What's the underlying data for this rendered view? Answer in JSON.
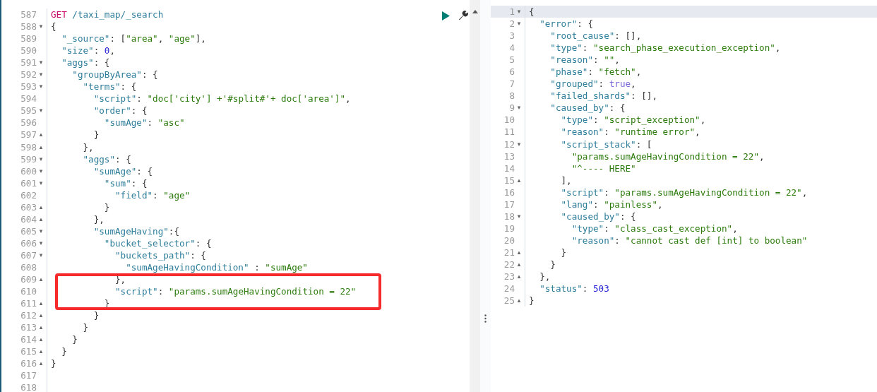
{
  "request_editor": {
    "lines": [
      {
        "number": "587",
        "code": [
          {
            "kind": "method",
            "text": "GET"
          },
          {
            "kind": "path",
            "text": " /taxi_map/_search"
          }
        ]
      },
      {
        "number": "588",
        "fold": "▾",
        "code": [
          {
            "kind": "punct",
            "text": "{"
          }
        ]
      },
      {
        "number": "589",
        "code": [
          {
            "kind": "key",
            "text": "  \"_source\""
          },
          {
            "kind": "punct",
            "text": ": ["
          },
          {
            "kind": "string",
            "text": "\"area\""
          },
          {
            "kind": "punct",
            "text": ", "
          },
          {
            "kind": "string",
            "text": "\"age\""
          },
          {
            "kind": "punct",
            "text": "],"
          }
        ]
      },
      {
        "number": "590",
        "code": [
          {
            "kind": "key",
            "text": "  \"size\""
          },
          {
            "kind": "punct",
            "text": ": "
          },
          {
            "kind": "number",
            "text": "0"
          },
          {
            "kind": "punct",
            "text": ","
          }
        ]
      },
      {
        "number": "591",
        "fold": "▾",
        "code": [
          {
            "kind": "key",
            "text": "  \"aggs\""
          },
          {
            "kind": "punct",
            "text": ": {"
          }
        ]
      },
      {
        "number": "592",
        "fold": "▾",
        "code": [
          {
            "kind": "key",
            "text": "    \"groupByArea\""
          },
          {
            "kind": "punct",
            "text": ": {"
          }
        ]
      },
      {
        "number": "593",
        "fold": "▾",
        "code": [
          {
            "kind": "key",
            "text": "      \"terms\""
          },
          {
            "kind": "punct",
            "text": ": {"
          }
        ]
      },
      {
        "number": "594",
        "code": [
          {
            "kind": "key",
            "text": "        \"script\""
          },
          {
            "kind": "punct",
            "text": ": "
          },
          {
            "kind": "string",
            "text": "\"doc['city'] +'#split#'+ doc['area']\""
          },
          {
            "kind": "punct",
            "text": ","
          }
        ]
      },
      {
        "number": "595",
        "fold": "▾",
        "code": [
          {
            "kind": "key",
            "text": "        \"order\""
          },
          {
            "kind": "punct",
            "text": ": {"
          }
        ]
      },
      {
        "number": "596",
        "code": [
          {
            "kind": "key",
            "text": "          \"sumAge\""
          },
          {
            "kind": "punct",
            "text": ": "
          },
          {
            "kind": "string",
            "text": "\"asc\""
          }
        ]
      },
      {
        "number": "597",
        "fold": "▴",
        "code": [
          {
            "kind": "punct",
            "text": "        }"
          }
        ]
      },
      {
        "number": "598",
        "fold": "▴",
        "code": [
          {
            "kind": "punct",
            "text": "      },"
          }
        ]
      },
      {
        "number": "599",
        "fold": "▾",
        "code": [
          {
            "kind": "key",
            "text": "      \"aggs\""
          },
          {
            "kind": "punct",
            "text": ": {"
          }
        ]
      },
      {
        "number": "600",
        "fold": "▾",
        "code": [
          {
            "kind": "key",
            "text": "        \"sumAge\""
          },
          {
            "kind": "punct",
            "text": ": {"
          }
        ]
      },
      {
        "number": "601",
        "fold": "▾",
        "code": [
          {
            "kind": "key",
            "text": "          \"sum\""
          },
          {
            "kind": "punct",
            "text": ": {"
          }
        ]
      },
      {
        "number": "602",
        "code": [
          {
            "kind": "key",
            "text": "            \"field\""
          },
          {
            "kind": "punct",
            "text": ": "
          },
          {
            "kind": "string",
            "text": "\"age\""
          }
        ]
      },
      {
        "number": "603",
        "fold": "▴",
        "code": [
          {
            "kind": "punct",
            "text": "          }"
          }
        ]
      },
      {
        "number": "604",
        "fold": "▴",
        "code": [
          {
            "kind": "punct",
            "text": "        },"
          }
        ]
      },
      {
        "number": "605",
        "fold": "▾",
        "code": [
          {
            "kind": "key",
            "text": "        \"sumAgeHaving\""
          },
          {
            "kind": "punct",
            "text": ":{"
          }
        ]
      },
      {
        "number": "606",
        "fold": "▾",
        "code": [
          {
            "kind": "key",
            "text": "          \"bucket_selector\""
          },
          {
            "kind": "punct",
            "text": ": {"
          }
        ]
      },
      {
        "number": "607",
        "fold": "▾",
        "code": [
          {
            "kind": "key",
            "text": "            \"buckets_path\""
          },
          {
            "kind": "punct",
            "text": ": {"
          }
        ]
      },
      {
        "number": "608",
        "code": [
          {
            "kind": "key",
            "text": "              \"sumAgeHavingCondition\""
          },
          {
            "kind": "punct",
            "text": " : "
          },
          {
            "kind": "string",
            "text": "\"sumAge\""
          }
        ]
      },
      {
        "number": "609",
        "fold": "▴",
        "code": [
          {
            "kind": "punct",
            "text": "            },"
          }
        ]
      },
      {
        "number": "610",
        "code": [
          {
            "kind": "key",
            "text": "            \"script\""
          },
          {
            "kind": "punct",
            "text": ": "
          },
          {
            "kind": "string",
            "text": "\"params.sumAgeHavingCondition = 22\""
          }
        ]
      },
      {
        "number": "611",
        "fold": "▴",
        "code": [
          {
            "kind": "punct",
            "text": "          }"
          }
        ]
      },
      {
        "number": "612",
        "fold": "▴",
        "code": [
          {
            "kind": "punct",
            "text": "        }"
          }
        ]
      },
      {
        "number": "613",
        "fold": "▴",
        "code": [
          {
            "kind": "punct",
            "text": "      }"
          }
        ]
      },
      {
        "number": "614",
        "fold": "▴",
        "code": [
          {
            "kind": "punct",
            "text": "    }"
          }
        ]
      },
      {
        "number": "615",
        "fold": "▴",
        "code": [
          {
            "kind": "punct",
            "text": "  }"
          }
        ]
      },
      {
        "number": "616",
        "fold": "▴",
        "code": [
          {
            "kind": "punct",
            "text": "}"
          }
        ]
      },
      {
        "number": "617"
      },
      {
        "number": "618"
      }
    ]
  },
  "response_editor": {
    "lines": [
      {
        "number": "1",
        "active": true,
        "fold": "▾",
        "code": [
          {
            "kind": "punct",
            "text": "{"
          }
        ]
      },
      {
        "number": "2",
        "active": false,
        "fold": "▾",
        "code": [
          {
            "kind": "key",
            "text": "  \"error\""
          },
          {
            "kind": "punct",
            "text": ": {"
          }
        ]
      },
      {
        "number": "3",
        "active": false,
        "code": [
          {
            "kind": "key",
            "text": "    \"root_cause\""
          },
          {
            "kind": "punct",
            "text": ": [],"
          }
        ]
      },
      {
        "number": "4",
        "active": false,
        "code": [
          {
            "kind": "key",
            "text": "    \"type\""
          },
          {
            "kind": "punct",
            "text": ": "
          },
          {
            "kind": "string",
            "text": "\"search_phase_execution_exception\""
          },
          {
            "kind": "punct",
            "text": ","
          }
        ]
      },
      {
        "number": "5",
        "active": false,
        "code": [
          {
            "kind": "key",
            "text": "    \"reason\""
          },
          {
            "kind": "punct",
            "text": ": "
          },
          {
            "kind": "string",
            "text": "\"\""
          },
          {
            "kind": "punct",
            "text": ","
          }
        ]
      },
      {
        "number": "6",
        "active": false,
        "code": [
          {
            "kind": "key",
            "text": "    \"phase\""
          },
          {
            "kind": "punct",
            "text": ": "
          },
          {
            "kind": "string",
            "text": "\"fetch\""
          },
          {
            "kind": "punct",
            "text": ","
          }
        ]
      },
      {
        "number": "7",
        "active": false,
        "code": [
          {
            "kind": "key",
            "text": "    \"grouped\""
          },
          {
            "kind": "punct",
            "text": ": "
          },
          {
            "kind": "boolean",
            "text": "true"
          },
          {
            "kind": "punct",
            "text": ","
          }
        ]
      },
      {
        "number": "8",
        "active": false,
        "code": [
          {
            "kind": "key",
            "text": "    \"failed_shards\""
          },
          {
            "kind": "punct",
            "text": ": [],"
          }
        ]
      },
      {
        "number": "9",
        "active": false,
        "fold": "▾",
        "code": [
          {
            "kind": "key",
            "text": "    \"caused_by\""
          },
          {
            "kind": "punct",
            "text": ": {"
          }
        ]
      },
      {
        "number": "10",
        "active": false,
        "code": [
          {
            "kind": "key",
            "text": "      \"type\""
          },
          {
            "kind": "punct",
            "text": ": "
          },
          {
            "kind": "string",
            "text": "\"script_exception\""
          },
          {
            "kind": "punct",
            "text": ","
          }
        ]
      },
      {
        "number": "11",
        "active": false,
        "code": [
          {
            "kind": "key",
            "text": "      \"reason\""
          },
          {
            "kind": "punct",
            "text": ": "
          },
          {
            "kind": "string",
            "text": "\"runtime error\""
          },
          {
            "kind": "punct",
            "text": ","
          }
        ]
      },
      {
        "number": "12",
        "active": false,
        "fold": "▾",
        "code": [
          {
            "kind": "key",
            "text": "      \"script_stack\""
          },
          {
            "kind": "punct",
            "text": ": ["
          }
        ]
      },
      {
        "number": "13",
        "active": false,
        "code": [
          {
            "kind": "string",
            "text": "        \"params.sumAgeHavingCondition = 22\""
          },
          {
            "kind": "punct",
            "text": ","
          }
        ]
      },
      {
        "number": "14",
        "active": false,
        "code": [
          {
            "kind": "string",
            "text": "        \"^---- HERE\""
          }
        ]
      },
      {
        "number": "15",
        "active": false,
        "fold": "▴",
        "code": [
          {
            "kind": "punct",
            "text": "      ],"
          }
        ]
      },
      {
        "number": "16",
        "active": false,
        "code": [
          {
            "kind": "key",
            "text": "      \"script\""
          },
          {
            "kind": "punct",
            "text": ": "
          },
          {
            "kind": "string",
            "text": "\"params.sumAgeHavingCondition = 22\""
          },
          {
            "kind": "punct",
            "text": ","
          }
        ]
      },
      {
        "number": "17",
        "active": false,
        "code": [
          {
            "kind": "key",
            "text": "      \"lang\""
          },
          {
            "kind": "punct",
            "text": ": "
          },
          {
            "kind": "string",
            "text": "\"painless\""
          },
          {
            "kind": "punct",
            "text": ","
          }
        ]
      },
      {
        "number": "18",
        "active": false,
        "fold": "▾",
        "code": [
          {
            "kind": "key",
            "text": "      \"caused_by\""
          },
          {
            "kind": "punct",
            "text": ": {"
          }
        ]
      },
      {
        "number": "19",
        "active": false,
        "code": [
          {
            "kind": "key",
            "text": "        \"type\""
          },
          {
            "kind": "punct",
            "text": ": "
          },
          {
            "kind": "string",
            "text": "\"class_cast_exception\""
          },
          {
            "kind": "punct",
            "text": ","
          }
        ]
      },
      {
        "number": "20",
        "active": false,
        "code": [
          {
            "kind": "key",
            "text": "        \"reason\""
          },
          {
            "kind": "punct",
            "text": ": "
          },
          {
            "kind": "string",
            "text": "\"cannot cast def [int] to boolean\""
          }
        ]
      },
      {
        "number": "21",
        "active": false,
        "fold": "▴",
        "code": [
          {
            "kind": "punct",
            "text": "      }"
          }
        ]
      },
      {
        "number": "22",
        "active": false,
        "fold": "▴",
        "code": [
          {
            "kind": "punct",
            "text": "    }"
          }
        ]
      },
      {
        "number": "23",
        "active": false,
        "fold": "▴",
        "code": [
          {
            "kind": "punct",
            "text": "  },"
          }
        ]
      },
      {
        "number": "24",
        "active": false,
        "code": [
          {
            "kind": "key",
            "text": "  \"status\""
          },
          {
            "kind": "punct",
            "text": ": "
          },
          {
            "kind": "number",
            "text": "503"
          }
        ]
      },
      {
        "number": "25",
        "active": false,
        "fold": "▴",
        "code": [
          {
            "kind": "punct",
            "text": "}"
          }
        ]
      }
    ]
  }
}
